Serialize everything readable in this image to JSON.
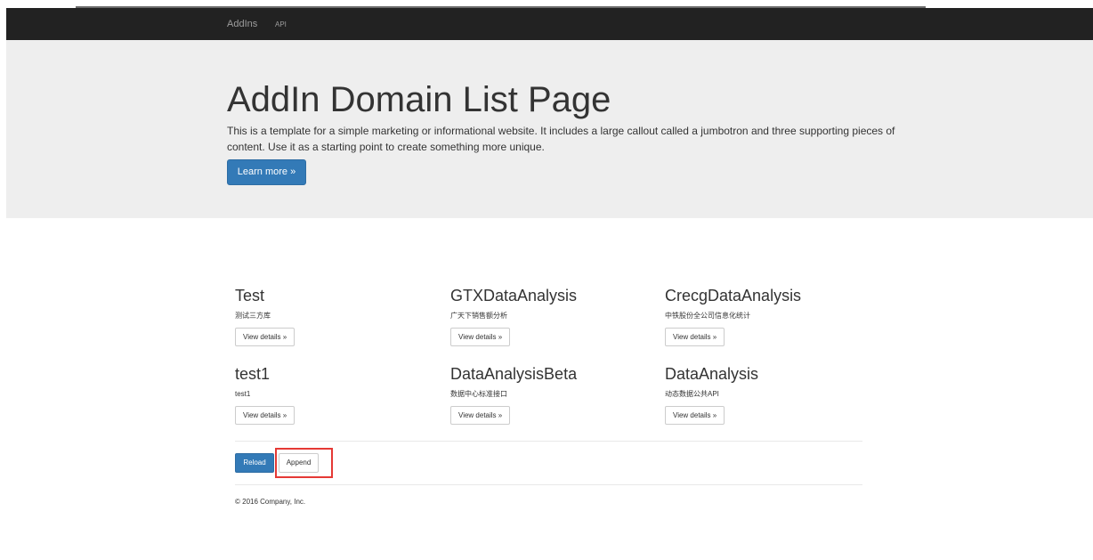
{
  "navbar": {
    "brand": "AddIns",
    "links": [
      "API"
    ]
  },
  "jumbotron": {
    "title": "AddIn Domain List Page",
    "text": "This is a template for a simple marketing or informational website. It includes a large callout called a jumbotron and three supporting pieces of content. Use it as a starting point to create something more unique.",
    "button_label": "Learn more »"
  },
  "domains": [
    {
      "title": "Test",
      "desc": "测试三方库",
      "button": "View details »"
    },
    {
      "title": "GTXDataAnalysis",
      "desc": "广天下销售额分析",
      "button": "View details »"
    },
    {
      "title": "CrecgDataAnalysis",
      "desc": "中铁股份全公司信息化统计",
      "button": "View details »"
    },
    {
      "title": "test1",
      "desc": "test1",
      "button": "View details »"
    },
    {
      "title": "DataAnalysisBeta",
      "desc": "数据中心标准接口",
      "button": "View details »"
    },
    {
      "title": "DataAnalysis",
      "desc": "动态数据公共API",
      "button": "View details »"
    }
  ],
  "actions": {
    "reload_label": "Reload",
    "append_label": "Append"
  },
  "footer": {
    "text": "© 2016 Company, Inc."
  },
  "colors": {
    "navbar": "#222222",
    "jumbotron": "#eeeeee",
    "primary": "#337ab7",
    "highlight": "#e53935"
  }
}
